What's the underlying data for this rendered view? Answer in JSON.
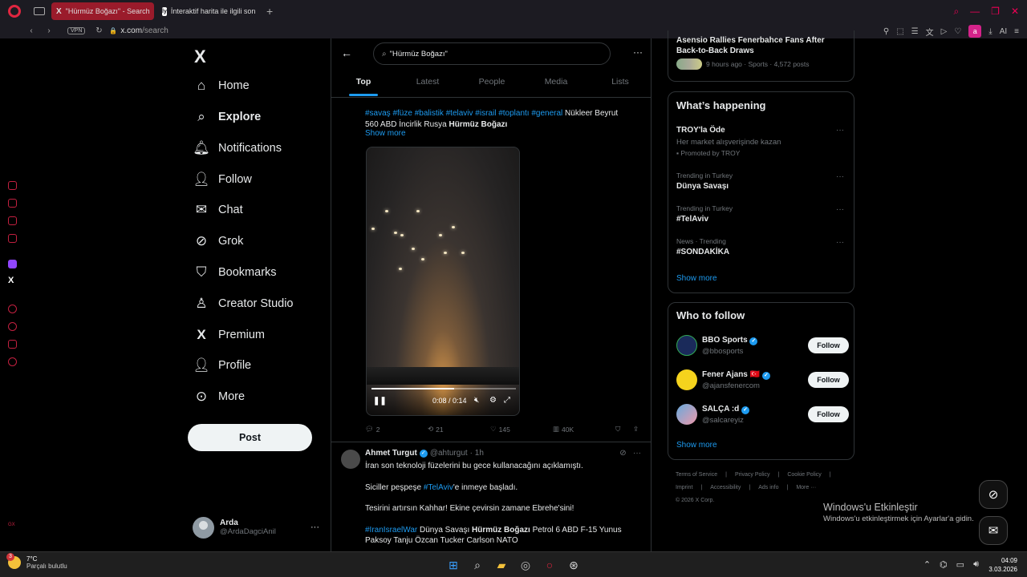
{
  "browser": {
    "tabs": [
      {
        "label": "\"Hürmüz Boğazı\" - Search",
        "favicon": "X",
        "active": true
      },
      {
        "label": "İnteraktif harita ile ilgili son",
        "favicon": "ly",
        "active": false
      }
    ],
    "new_tab": "+",
    "vpn": "VPN",
    "url_host": "x.com",
    "url_path": "/search",
    "ext_badge": "a",
    "ai_label": "AI"
  },
  "nav": {
    "logo": "X",
    "items": [
      {
        "label": "Home",
        "icon": "home-icon"
      },
      {
        "label": "Explore",
        "icon": "search-icon",
        "bold": true
      },
      {
        "label": "Notifications",
        "icon": "bell-icon"
      },
      {
        "label": "Follow",
        "icon": "person-add-icon"
      },
      {
        "label": "Chat",
        "icon": "mail-icon"
      },
      {
        "label": "Grok",
        "icon": "grok-icon"
      },
      {
        "label": "Bookmarks",
        "icon": "bookmark-icon"
      },
      {
        "label": "Creator Studio",
        "icon": "creator-icon"
      },
      {
        "label": "Premium",
        "icon": "x-icon"
      },
      {
        "label": "Profile",
        "icon": "person-icon"
      },
      {
        "label": "More",
        "icon": "more-circle-icon"
      }
    ],
    "post_label": "Post",
    "account": {
      "name": "Arda",
      "handle": "@ArdaDagciAnil"
    }
  },
  "search": {
    "query": "\"Hürmüz Boğazı\"",
    "tabs": [
      "Top",
      "Latest",
      "People",
      "Media",
      "Lists"
    ],
    "selected": "Top"
  },
  "tweet1": {
    "tags_line1": "#savaş #füze #balistik #telaviv #israil #toplantı #general",
    "text_line1_rest": " Nükleer Beyrut",
    "text_line2": "560 ABD İncirlik Rusya ",
    "text_line2_bold": "Hürmüz Boğazı",
    "show_more": "Show more",
    "video": {
      "time": "0:08 / 0:14",
      "progress": 0.57
    },
    "replies": "2",
    "retweets": "21",
    "likes": "145",
    "views": "40K"
  },
  "tweet2": {
    "name": "Ahmet Turgut",
    "handle": "@ahturgut",
    "time": "· 1h",
    "line1": "İran son teknoloji füzelerini bu gece kullanacağını açıklamıştı.",
    "line2_pre": "Siciller peşpeşe ",
    "line2_tag": "#TelAviv",
    "line2_post": "'e inmeye başladı.",
    "line3": "Tesirini artırsın Kahhar! Ekine çevirsin zamane Ebrehe'sini!",
    "line4_tag": "#IranIsraelWar",
    "line4_mid": " Dünya Savaşı ",
    "line4_bold": "Hürmüz Boğazı",
    "line4_post": " Petrol 6 ABD F-15 Yunus",
    "line5": "Paksoy Tanju Özcan Tucker Carlson NATO"
  },
  "right": {
    "top_card": {
      "title": "Asensio Rallies Fenerbahce Fans After Back-to-Back Draws",
      "meta": "9 hours ago · Sports · 4,572 posts"
    },
    "happening_title": "What’s happening",
    "trends": [
      {
        "meta": "",
        "name": "TROY'la Öde",
        "sub": "Her market alışverişinde kazan",
        "promo": "Promoted by TROY"
      },
      {
        "meta": "Trending in Turkey",
        "name": "Dünya Savaşı"
      },
      {
        "meta": "Trending in Turkey",
        "name": "#TelAviv"
      },
      {
        "meta": "News · Trending",
        "name": "#SONDAKİKA"
      }
    ],
    "show_more": "Show more",
    "wtf_title": "Who to follow",
    "wtf": [
      {
        "name": "BBO Sports",
        "handle": "@bbosports",
        "flag": ""
      },
      {
        "name": "Fener Ajans",
        "handle": "@ajansfenercom",
        "flag": "🇹🇷"
      },
      {
        "name": "SALÇA :d",
        "handle": "@salcareyiz",
        "flag": ""
      }
    ],
    "follow_label": "Follow",
    "footer1": [
      "Terms of Service",
      "|",
      "Privacy Policy",
      "|",
      "Cookie Policy",
      "|"
    ],
    "footer2": [
      "Imprint",
      "|",
      "Accessibility",
      "|",
      "Ads info",
      "|",
      "More ···"
    ],
    "footer3": "© 2026 X Corp."
  },
  "watermark": {
    "line1": "Windows'u Etkinleştir",
    "line2": "Windows'u etkinleştirmek için Ayarlar'a gidin."
  },
  "taskbar": {
    "temp": "7°C",
    "condition": "Parçalı bulutlu",
    "badge": "3",
    "time": "04:09",
    "date": "3.03.2026"
  }
}
